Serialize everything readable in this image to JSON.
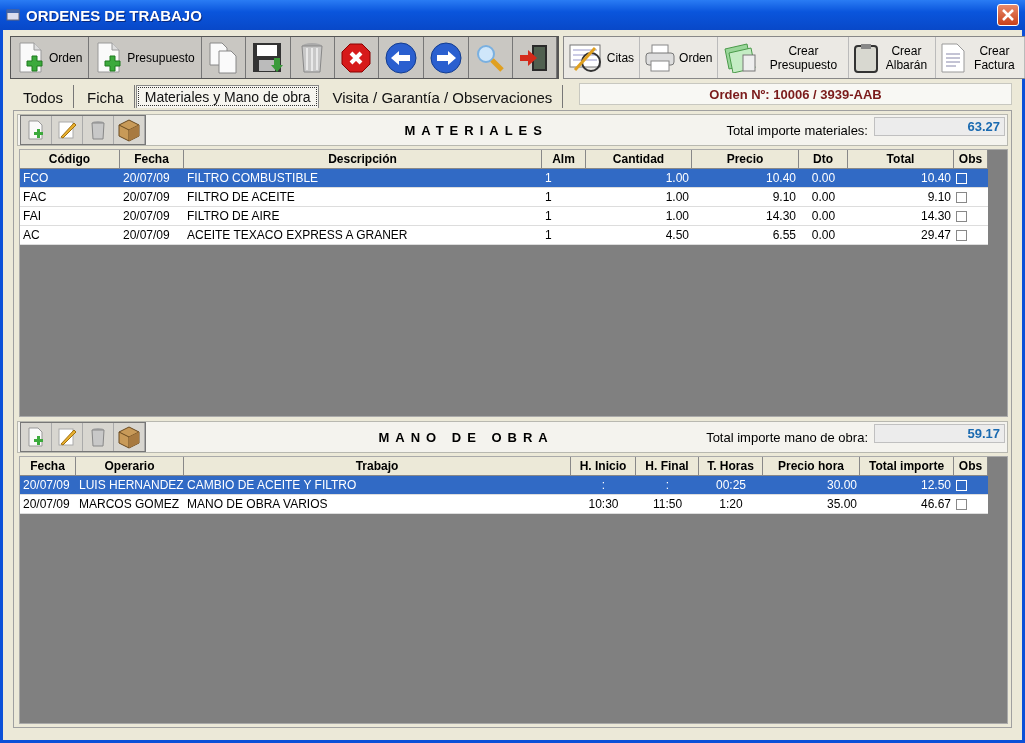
{
  "window": {
    "title": "ORDENES DE TRABAJO"
  },
  "toolbar": [
    {
      "kind": "new-doc",
      "label": "Orden"
    },
    {
      "kind": "new-doc",
      "label": "Presupuesto"
    },
    {
      "kind": "copy"
    },
    {
      "kind": "save"
    },
    {
      "kind": "trash"
    },
    {
      "kind": "cancel"
    },
    {
      "kind": "back"
    },
    {
      "kind": "forward"
    },
    {
      "kind": "search"
    },
    {
      "kind": "exit"
    }
  ],
  "actions": [
    {
      "kind": "calendar",
      "label": "Citas"
    },
    {
      "kind": "printer",
      "label": "Orden"
    },
    {
      "kind": "money",
      "label": "Crear Presupuesto"
    },
    {
      "kind": "clipboard",
      "label": "Crear Albarán"
    },
    {
      "kind": "document",
      "label": "Crear Factura"
    }
  ],
  "tabs": [
    {
      "label": "Todos",
      "selected": false
    },
    {
      "label": "Ficha",
      "selected": false
    },
    {
      "label": "Materiales y Mano de obra",
      "selected": true
    },
    {
      "label": "Visita / Garantía / Observaciones",
      "selected": false
    }
  ],
  "order_label": "Orden Nº: 10006 / 3939-AAB",
  "materials": {
    "title": "MATERIALES",
    "total_label": "Total importe materiales:",
    "total": "63.27",
    "columns": [
      "Código",
      "Fecha",
      "Descripción",
      "Alm",
      "Cantidad",
      "Precio",
      "Dto",
      "Total",
      "Obs"
    ],
    "rows": [
      {
        "cells": [
          "FCO",
          "20/07/09",
          "FILTRO COMBUSTIBLE",
          "1",
          "1.00",
          "10.40",
          "0.00",
          "10.40"
        ],
        "obs": false,
        "selected": true
      },
      {
        "cells": [
          "FAC",
          "20/07/09",
          "FILTRO DE ACEITE",
          "1",
          "1.00",
          "9.10",
          "0.00",
          "9.10"
        ],
        "obs": false,
        "selected": false
      },
      {
        "cells": [
          "FAI",
          "20/07/09",
          "FILTRO DE AIRE",
          "1",
          "1.00",
          "14.30",
          "0.00",
          "14.30"
        ],
        "obs": false,
        "selected": false
      },
      {
        "cells": [
          "AC",
          "20/07/09",
          "ACEITE TEXACO EXPRESS A GRANER",
          "1",
          "4.50",
          "6.55",
          "0.00",
          "29.47"
        ],
        "obs": false,
        "selected": false
      }
    ]
  },
  "labor": {
    "title": "MANO DE OBRA",
    "total_label": "Total importe mano de obra:",
    "total": "59.17",
    "columns": [
      "Fecha",
      "Operario",
      "Trabajo",
      "H. Inicio",
      "H. Final",
      "T. Horas",
      "Precio hora",
      "Total importe",
      "Obs"
    ],
    "rows": [
      {
        "cells": [
          "20/07/09",
          "LUIS HERNANDEZ",
          "CAMBIO DE ACEITE Y FILTRO",
          ":",
          ":",
          "00:25",
          "30.00",
          "12.50"
        ],
        "obs": false,
        "selected": true
      },
      {
        "cells": [
          "20/07/09",
          "MARCOS GOMEZ",
          "MANO DE OBRA VARIOS",
          "10:30",
          "11:50",
          "1:20",
          "35.00",
          "46.67"
        ],
        "obs": false,
        "selected": false
      }
    ]
  }
}
